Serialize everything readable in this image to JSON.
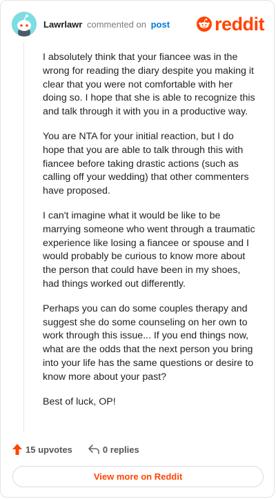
{
  "header": {
    "username": "Lawrlawr",
    "action_text": "commented on",
    "post_link": "post",
    "brand": "reddit",
    "brand_icon": "reddit-alien-logo",
    "avatar_icon": "snoo-avatar",
    "brand_color": "#ff4500",
    "link_color": "#0079d3"
  },
  "comment": {
    "paragraphs": [
      "I absolutely think that your fiancee was in the wrong for reading the diary despite you making it clear that you were not comfortable with her doing so. I hope that she is able to recognize this and talk through it with you in a productive way.",
      "You are NTA for your initial reaction, but I do hope that you are able to talk through this with fiancee before taking drastic actions (such as calling off your wedding) that other commenters have proposed.",
      "I can't imagine what it would be like to be marrying someone who went through a traumatic experience like losing a fiancee or spouse and I would probably be curious to know more about the person that could have been in my shoes, had things worked out differently.",
      "Perhaps you can do some couples therapy and suggest she do some counseling on her own to work through this issue... If you end things now, what are the odds that the next person you bring into your life has the same questions or desire to know more about your past?",
      "Best of luck, OP!"
    ]
  },
  "footer": {
    "upvotes": "15 upvotes",
    "upvote_icon": "upvote-arrow-icon",
    "replies": "0 replies",
    "reply_icon": "reply-arrow-icon",
    "view_more": "View more on Reddit"
  }
}
